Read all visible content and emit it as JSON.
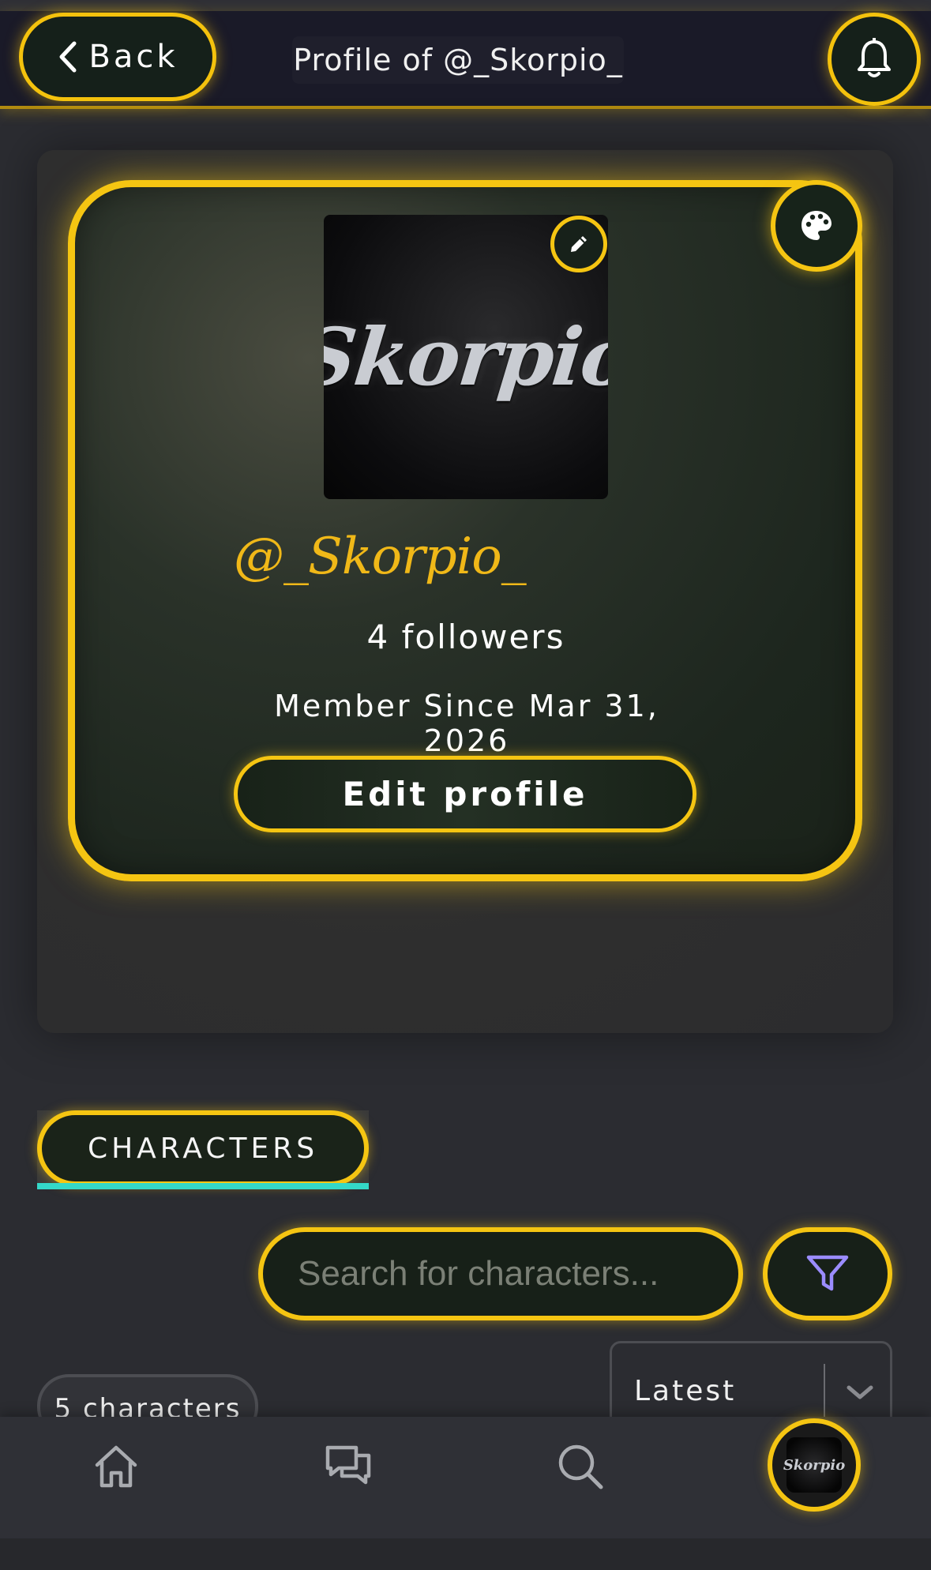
{
  "header": {
    "back_label": "Back",
    "title": "Profile of @_Skorpio_"
  },
  "profile": {
    "avatar_text": "Skorpio",
    "username": "@_Skorpio_",
    "followers": "4 followers",
    "member_since": "Member Since Mar 31, 2026",
    "edit_profile_label": "Edit profile"
  },
  "tabs": {
    "characters_label": "CHARACTERS"
  },
  "search": {
    "placeholder": "Search for characters..."
  },
  "list": {
    "count_label": "5 characters",
    "sort_value": "Latest"
  },
  "bottom_nav": {
    "avatar_text": "Skorpio"
  },
  "colors": {
    "accent": "#f5c512",
    "tab_underline": "#34d8c8",
    "username": "#f0b818",
    "filter_icon": "#9b8cff"
  },
  "icons": [
    "chevron-left-icon",
    "bell-icon",
    "palette-icon",
    "pencil-icon",
    "filter-icon",
    "chevron-down-icon",
    "home-icon",
    "chat-icon",
    "search-icon"
  ]
}
